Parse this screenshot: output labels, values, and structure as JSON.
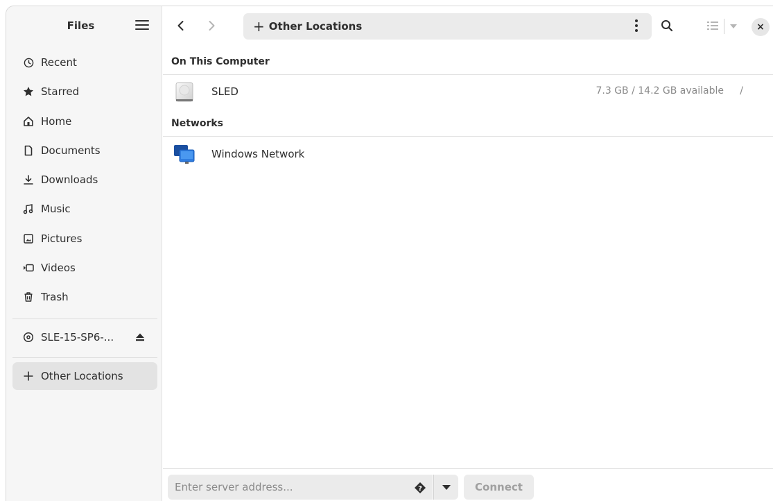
{
  "sidebar": {
    "title": "Files",
    "items": [
      {
        "label": "Recent",
        "icon": "clock-icon"
      },
      {
        "label": "Starred",
        "icon": "star-icon"
      },
      {
        "label": "Home",
        "icon": "home-icon"
      },
      {
        "label": "Documents",
        "icon": "document-icon"
      },
      {
        "label": "Downloads",
        "icon": "download-icon"
      },
      {
        "label": "Music",
        "icon": "music-icon"
      },
      {
        "label": "Pictures",
        "icon": "picture-icon"
      },
      {
        "label": "Videos",
        "icon": "video-icon"
      },
      {
        "label": "Trash",
        "icon": "trash-icon"
      }
    ],
    "device": {
      "label": "SLE-15-SP6-...",
      "icon": "disc-icon",
      "action_icon": "eject-icon"
    },
    "other_locations": {
      "label": "Other Locations",
      "icon": "plus-icon"
    }
  },
  "header": {
    "path_label": "Other Locations",
    "path_icon": "plus-icon"
  },
  "content": {
    "section_computer": "On This Computer",
    "drive": {
      "name": "SLED",
      "info": "7.3 GB / 14.2 GB available",
      "mount": "/",
      "icon": "drive-icon"
    },
    "section_networks": "Networks",
    "network": {
      "name": "Windows Network",
      "icon": "network-icon"
    }
  },
  "footer": {
    "server_placeholder": "Enter server address...",
    "connect_label": "Connect"
  }
}
